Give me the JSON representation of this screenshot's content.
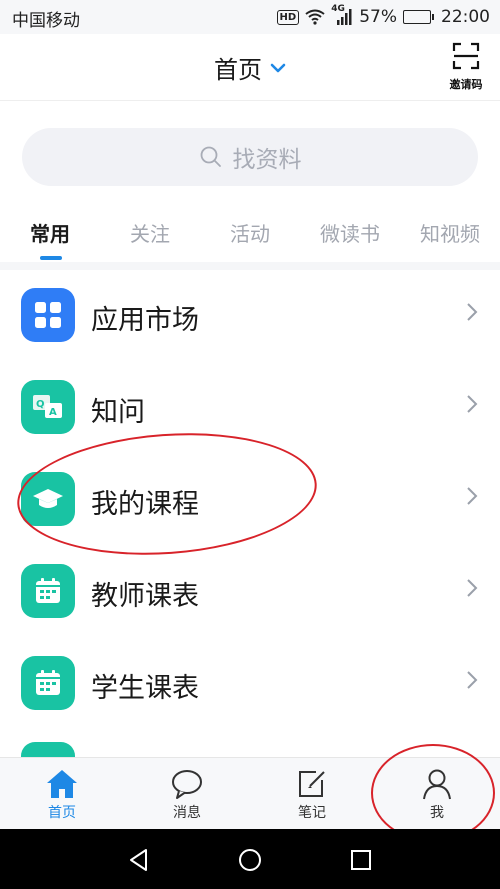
{
  "status_bar": {
    "carrier": "中国移动",
    "hd": "HD",
    "network": "4G",
    "battery_text": "57%",
    "battery_level": 0.57,
    "time": "22:00"
  },
  "header": {
    "title": "首页",
    "scan_label": "邀请码"
  },
  "search": {
    "placeholder": "找资料"
  },
  "tabs": [
    {
      "label": "常用",
      "active": true
    },
    {
      "label": "关注",
      "active": false
    },
    {
      "label": "活动",
      "active": false
    },
    {
      "label": "微读书",
      "active": false
    },
    {
      "label": "知视频",
      "active": false
    }
  ],
  "list": [
    {
      "label": "应用市场",
      "icon": "app-grid-icon",
      "color": "#2f7df6"
    },
    {
      "label": "知问",
      "icon": "qa-icon",
      "color": "#19c3a3"
    },
    {
      "label": "我的课程",
      "icon": "graduation-cap-icon",
      "color": "#19c3a3"
    },
    {
      "label": "教师课表",
      "icon": "calendar-icon",
      "color": "#19c3a3"
    },
    {
      "label": "学生课表",
      "icon": "calendar-icon",
      "color": "#19c3a3"
    }
  ],
  "tabbar": [
    {
      "label": "首页",
      "icon": "home-icon",
      "active": true
    },
    {
      "label": "消息",
      "icon": "chat-bubble-icon",
      "active": false
    },
    {
      "label": "笔记",
      "icon": "note-edit-icon",
      "active": false
    },
    {
      "label": "我",
      "icon": "user-icon",
      "active": false
    }
  ],
  "colors": {
    "accent": "#1e88e5",
    "annotation": "#d8232a",
    "app_market": "#2f7df6",
    "teal": "#19c3a3"
  }
}
